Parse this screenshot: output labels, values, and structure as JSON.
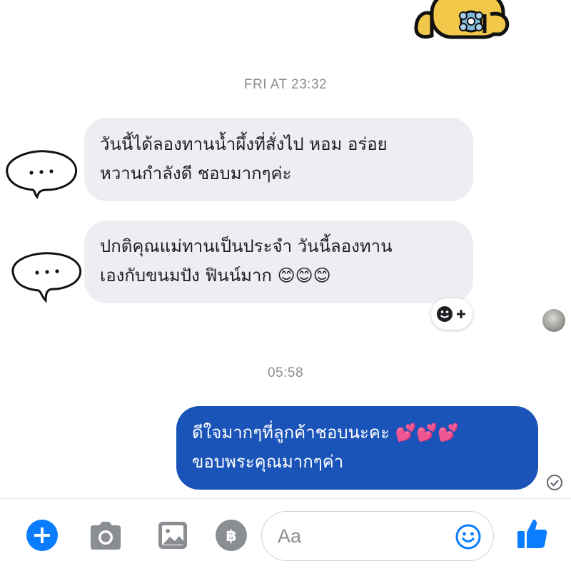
{
  "conversation": {
    "timestamp_1": "FRI AT 23:32",
    "timestamp_2": "05:58",
    "incoming_1": {
      "line1": "วันนี้ได้ลองทานน้ำผึ้งที่สั่งไป หอม อร่อย",
      "line2": "หวานกำลังดี ชอบมากๆค่ะ"
    },
    "incoming_2": {
      "line1": "ปกติคุณแม่ทานเป็นประจำ วันนี้ลองทาน",
      "line2": "เองกับขนมปัง ฟินน์มาก 😊😊😊"
    },
    "outgoing_1": {
      "line1": "ดีใจมากๆที่ลูกค้าชอบนะคะ 💕💕💕",
      "line2": "ขอบพระคุณมากๆค่า"
    }
  },
  "composer": {
    "placeholder": "Aa",
    "icons": [
      "plus-icon",
      "camera-icon",
      "image-icon",
      "baht-icon",
      "emoji-icon",
      "thumbs-up-icon"
    ]
  },
  "colors": {
    "outgoing_bubble": "#1a54b9",
    "incoming_bubble": "#eceef1",
    "accent": "#0a7cff",
    "timestamp": "#8a8d91"
  }
}
